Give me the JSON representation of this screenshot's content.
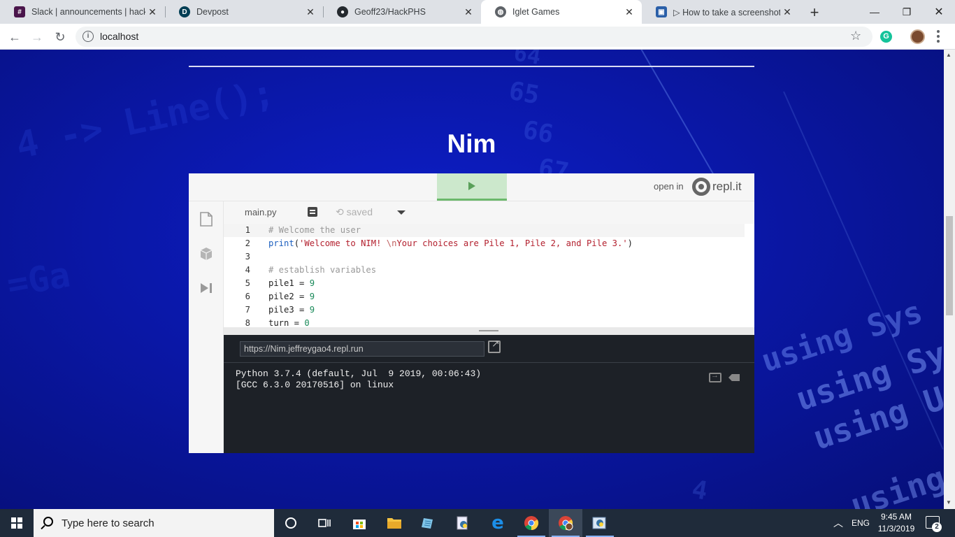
{
  "browser": {
    "tabs": [
      {
        "title": "Slack | announcements | hackP",
        "icon": "slack-icon",
        "color": "#4a154b",
        "active": false
      },
      {
        "title": "Devpost",
        "icon": "devpost-icon",
        "color": "#003e54",
        "active": false
      },
      {
        "title": "Geoff23/HackPHS",
        "icon": "github-icon",
        "color": "#24292e",
        "active": false
      },
      {
        "title": "Iglet Games",
        "icon": "globe-icon",
        "color": "#5f6368",
        "active": true
      },
      {
        "title": "▷ How to take a screenshot in",
        "icon": "screenshot-icon",
        "color": "#2a5fa8",
        "active": false
      }
    ],
    "address": "localhost"
  },
  "page": {
    "title": "Nim"
  },
  "repl": {
    "open_in": "open in",
    "brand": "repl.it",
    "filename": "main.py",
    "saved": "saved",
    "code_lines": [
      {
        "n": "1",
        "parts": [
          {
            "t": "# Welcome the user",
            "c": "c-com"
          }
        ]
      },
      {
        "n": "2",
        "parts": [
          {
            "t": "print",
            "c": "c-fn"
          },
          {
            "t": "(",
            "c": ""
          },
          {
            "t": "'Welcome to NIM! ",
            "c": "c-str"
          },
          {
            "t": "\\n",
            "c": "c-esc"
          },
          {
            "t": "Your choices are Pile 1, Pile 2, and Pile 3.'",
            "c": "c-str"
          },
          {
            "t": ")",
            "c": ""
          }
        ]
      },
      {
        "n": "3",
        "parts": []
      },
      {
        "n": "4",
        "parts": [
          {
            "t": "# establish variables",
            "c": "c-com"
          }
        ]
      },
      {
        "n": "5",
        "parts": [
          {
            "t": "pile1 = ",
            "c": ""
          },
          {
            "t": "9",
            "c": "c-num"
          }
        ]
      },
      {
        "n": "6",
        "parts": [
          {
            "t": "pile2 = ",
            "c": ""
          },
          {
            "t": "9",
            "c": "c-num"
          }
        ]
      },
      {
        "n": "7",
        "parts": [
          {
            "t": "pile3 = ",
            "c": ""
          },
          {
            "t": "9",
            "c": "c-num"
          }
        ]
      },
      {
        "n": "8",
        "parts": [
          {
            "t": "turn = ",
            "c": ""
          },
          {
            "t": "0",
            "c": "c-num"
          }
        ]
      }
    ],
    "run_url": "https://Nim.jeffreygao4.repl.run",
    "console_output": "Python 3.7.4 (default, Jul  9 2019, 00:06:43)\n[GCC 6.3.0 20170516] on linux"
  },
  "background_text": [
    "4 -> Line();",
    "=Ga",
    "64",
    "65",
    "66",
    "67",
    "using Sys",
    "using Sy",
    "using U",
    "using",
    "4"
  ],
  "taskbar": {
    "search_placeholder": "Type here to search",
    "language": "ENG",
    "time": "9:45 AM",
    "date": "11/3/2019",
    "notifications": "2",
    "apps": [
      "cortana-icon",
      "task-view-icon",
      "store-icon",
      "file-explorer-icon",
      "notepad-icon",
      "python-launcher-icon",
      "edge-icon",
      "chrome-icon",
      "chrome-profile-icon",
      "python-idle-icon"
    ]
  },
  "colors": {
    "page_bg": "#0a17a6",
    "run_button": "#cce8cc",
    "console_bg": "#1d2127",
    "taskbar_bg": "#1f2b3a"
  }
}
